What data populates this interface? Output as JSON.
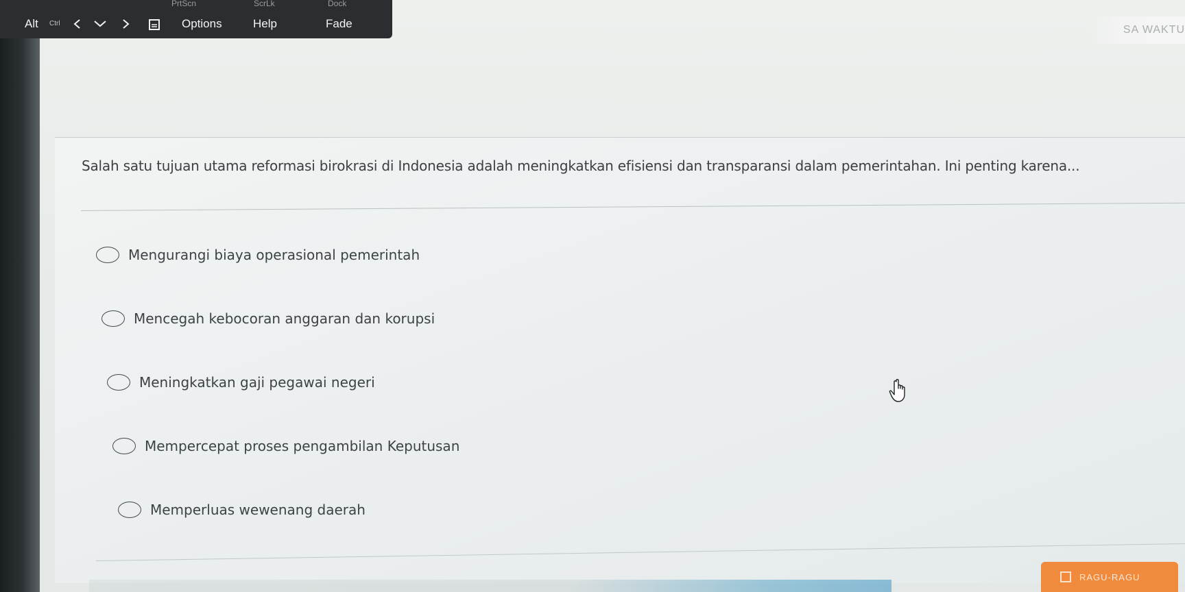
{
  "toolbar": {
    "ghost_labels": [
      "PrtScn",
      "ScrLk",
      "Dock"
    ],
    "alt_label": "Alt",
    "small_label": "Ctrl",
    "options_label": "Options",
    "help_label": "Help",
    "fade_label": "Fade"
  },
  "corner_label": "SA WAKTU",
  "question": {
    "text": "Salah satu tujuan utama reformasi birokrasi di Indonesia adalah meningkatkan efisiensi dan transparansi dalam pemerintahan. Ini penting karena..."
  },
  "options": [
    {
      "label": "Mengurangi biaya operasional pemerintah"
    },
    {
      "label": "Mencegah kebocoran anggaran dan korupsi"
    },
    {
      "label": "Meningkatkan gaji pegawai negeri"
    },
    {
      "label": "Mempercepat proses pengambilan Keputusan"
    },
    {
      "label": "Memperluas wewenang daerah"
    }
  ],
  "doubt_button": {
    "label": "RAGU-RAGU",
    "checked": false,
    "color": "#f08a3c"
  },
  "icons": {
    "toolbar": [
      "chevron-left-icon",
      "chevron-down-icon",
      "chevron-right-icon",
      "keyboard-icon"
    ],
    "options": "radio-icon",
    "cursor": "hand-pointer-icon"
  }
}
